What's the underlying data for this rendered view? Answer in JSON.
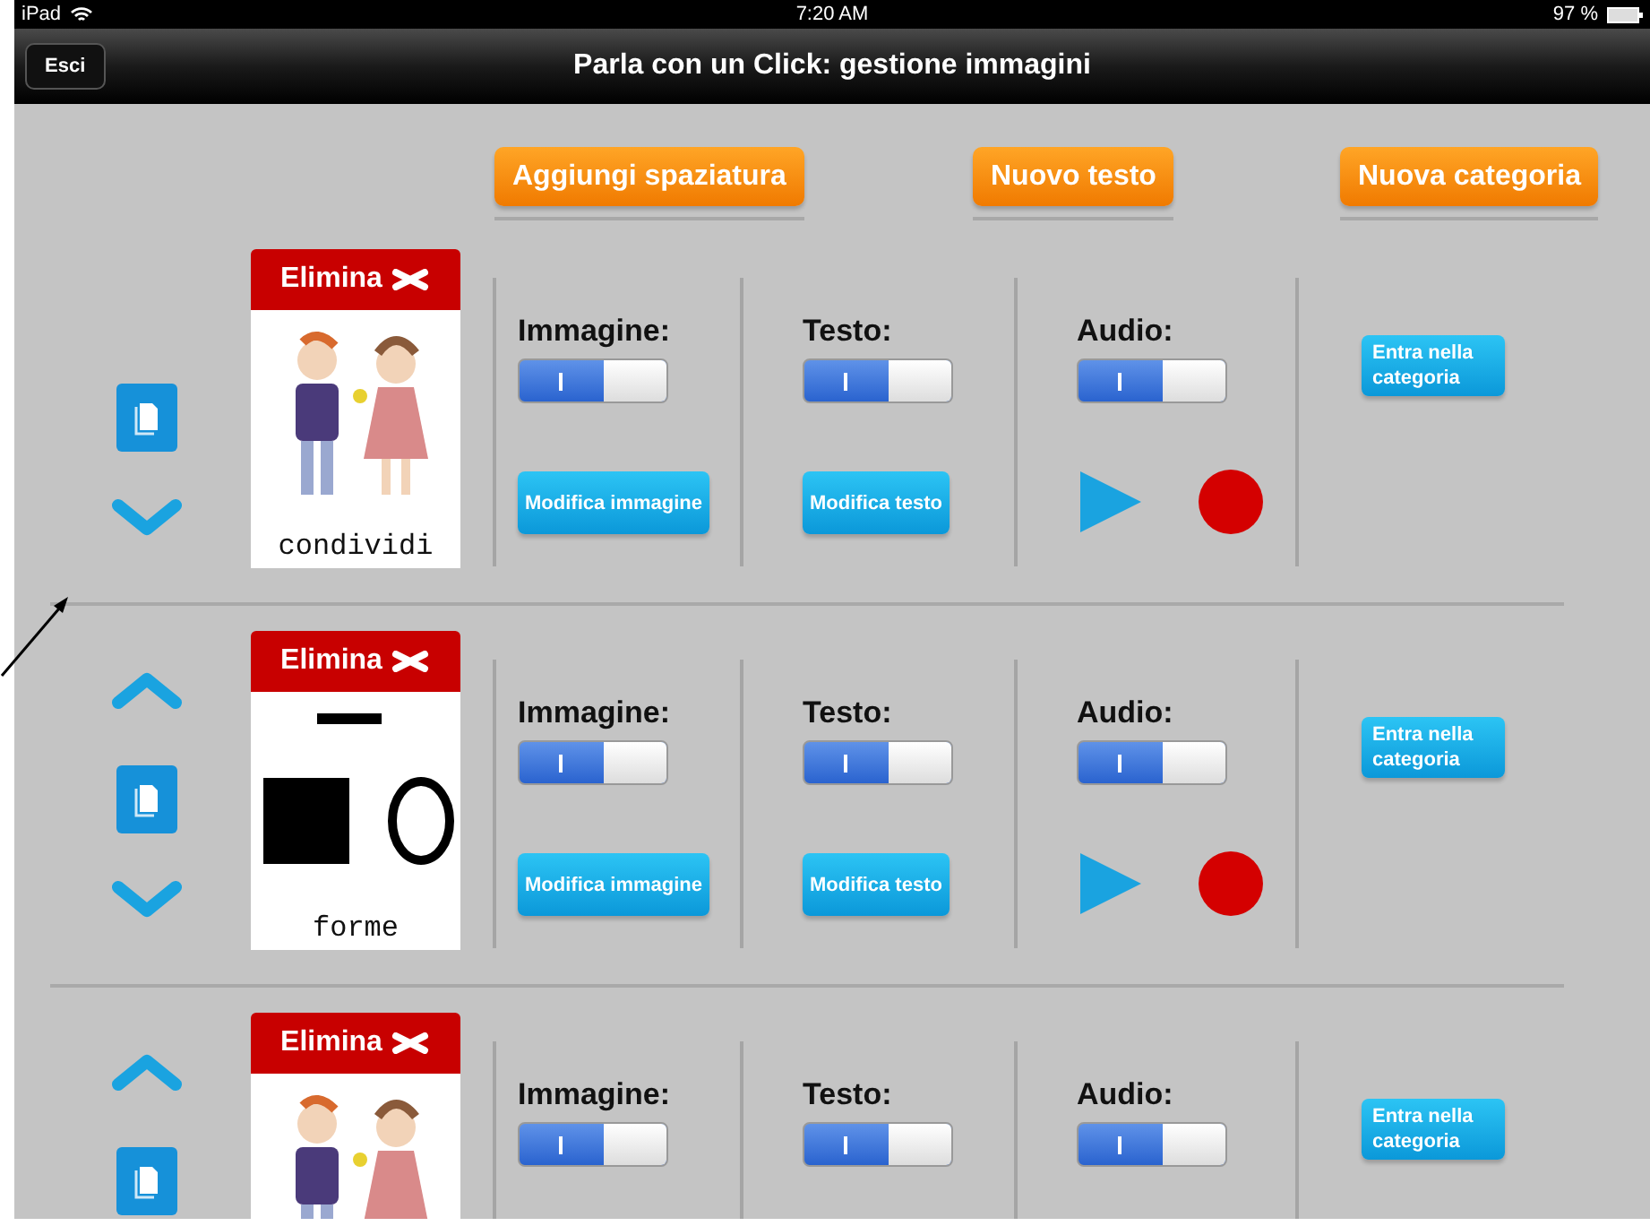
{
  "status_bar": {
    "device": "iPad",
    "time": "7:20 AM",
    "battery": "97 %"
  },
  "nav_bar": {
    "back_button": "Esci",
    "title": "Parla con un Click: gestione immagini"
  },
  "toolbar": [
    "Aggiungi spaziatura",
    "Nuovo testo",
    "Nuova categoria"
  ],
  "rows": [
    {
      "move_up": false,
      "move_down": true,
      "delete_label": "Elimina",
      "picture": {
        "kind": "people"
      },
      "caption": "condividi",
      "image": {
        "label": "Immagine:",
        "on": true,
        "button": "Modifica immagine"
      },
      "text": {
        "label": "Testo:",
        "on": true,
        "button": "Modifica testo"
      },
      "audio": {
        "label": "Audio:",
        "on": true,
        "controls": true
      },
      "enter_button": "Entra nella categoria"
    },
    {
      "move_up": true,
      "move_down": true,
      "delete_label": "Elimina",
      "picture": {
        "kind": "shapes"
      },
      "caption": "forme",
      "image": {
        "label": "Immagine:",
        "on": true,
        "button": "Modifica immagine"
      },
      "text": {
        "label": "Testo:",
        "on": true,
        "button": "Modifica testo"
      },
      "audio": {
        "label": "Audio:",
        "on": true,
        "controls": true
      },
      "enter_button": "Entra nella categoria"
    },
    {
      "move_up": true,
      "delete_label": "Elimina",
      "picture": {
        "kind": "people"
      },
      "image": {
        "label": "Immagine:",
        "on": true
      },
      "text": {
        "label": "Testo:",
        "on": true
      },
      "audio": {
        "label": "Audio:",
        "on": true,
        "controls": false
      },
      "enter_button": "Entra nella categoria"
    }
  ]
}
